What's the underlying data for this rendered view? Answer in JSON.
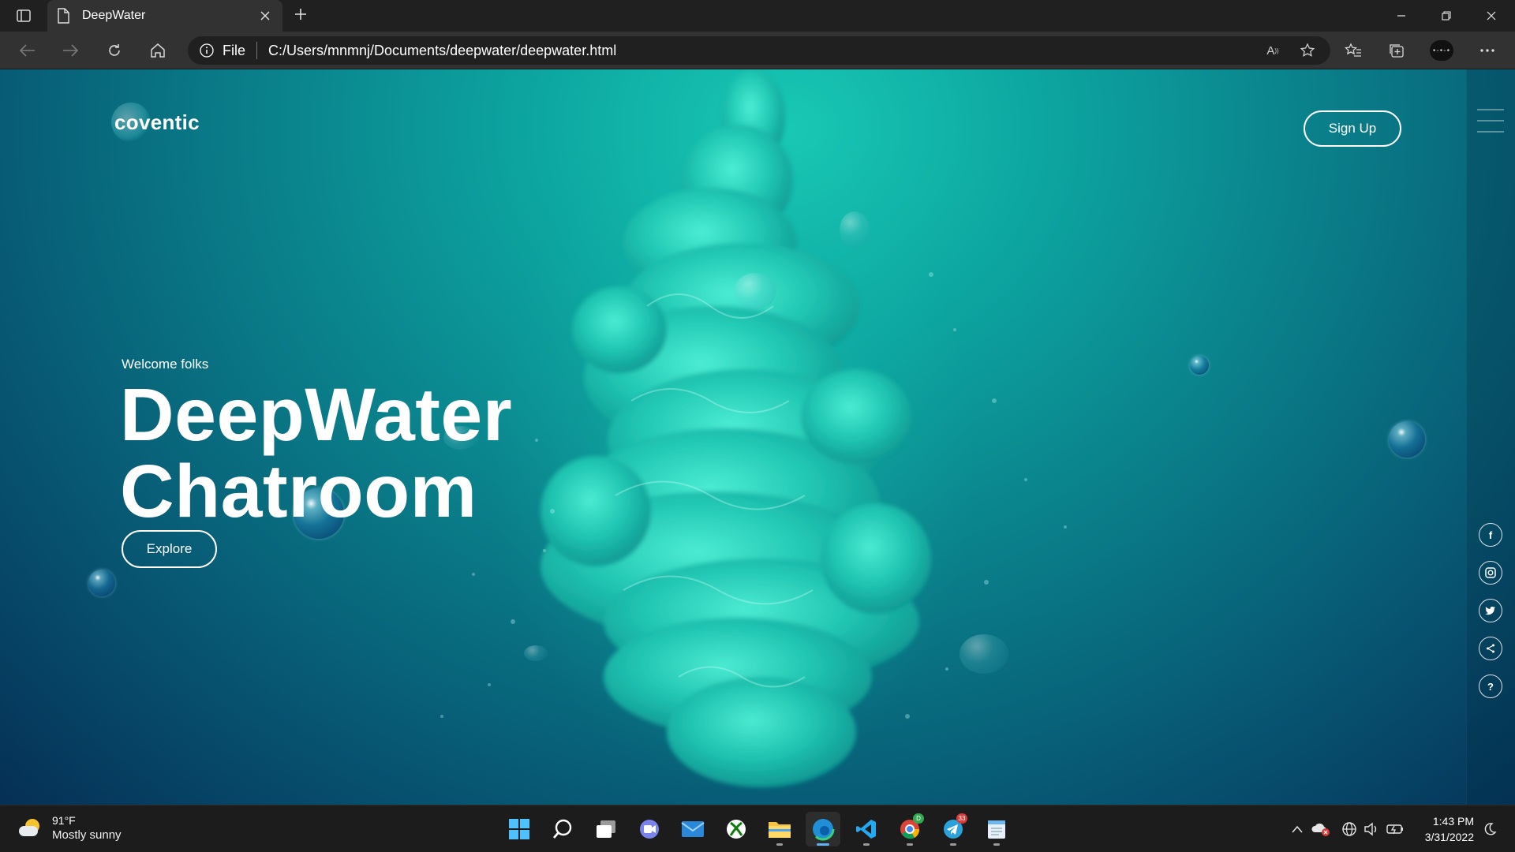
{
  "browser": {
    "tab": {
      "title": "DeepWater"
    },
    "address": {
      "protocol": "File",
      "url": "C:/Users/mnmnj/Documents/deepwater/deepwater.html"
    },
    "icons": [
      "tab-actions-icon",
      "document-icon",
      "close-icon",
      "plus-icon",
      "minimize-icon",
      "restore-icon",
      "close-window-icon",
      "back-icon",
      "forward-icon",
      "refresh-icon",
      "home-icon",
      "info-icon",
      "read-aloud-icon",
      "add-favorite-icon",
      "favorites-icon",
      "collections-icon",
      "profile-icon",
      "more-icon"
    ]
  },
  "page": {
    "logo": "coventic",
    "signup_label": "Sign Up",
    "welcome": "Welcome folks",
    "headline_line1": "DeepWater",
    "headline_line2": "Chatroom",
    "explore_label": "Explore",
    "social": [
      {
        "name": "facebook-icon",
        "glyph": "f"
      },
      {
        "name": "instagram-icon",
        "glyph": "◎"
      },
      {
        "name": "twitter-icon",
        "glyph": "🐦"
      },
      {
        "name": "share-icon",
        "glyph": "<"
      },
      {
        "name": "help-icon",
        "glyph": "?"
      }
    ]
  },
  "taskbar": {
    "weather": {
      "temp": "91°F",
      "condition": "Mostly sunny"
    },
    "apps": [
      "windows-start",
      "search",
      "task-view",
      "teams-chat",
      "mail",
      "xbox",
      "file-explorer",
      "edge",
      "vs-code",
      "chrome",
      "telegram",
      "notepad"
    ],
    "telegram_badge": "33",
    "clock": {
      "time": "1:43 PM",
      "date": "3/31/2022"
    }
  },
  "colors": {
    "accent": "#5fb2f2",
    "page_top": "#19c8b4",
    "page_bottom": "#062f55"
  }
}
